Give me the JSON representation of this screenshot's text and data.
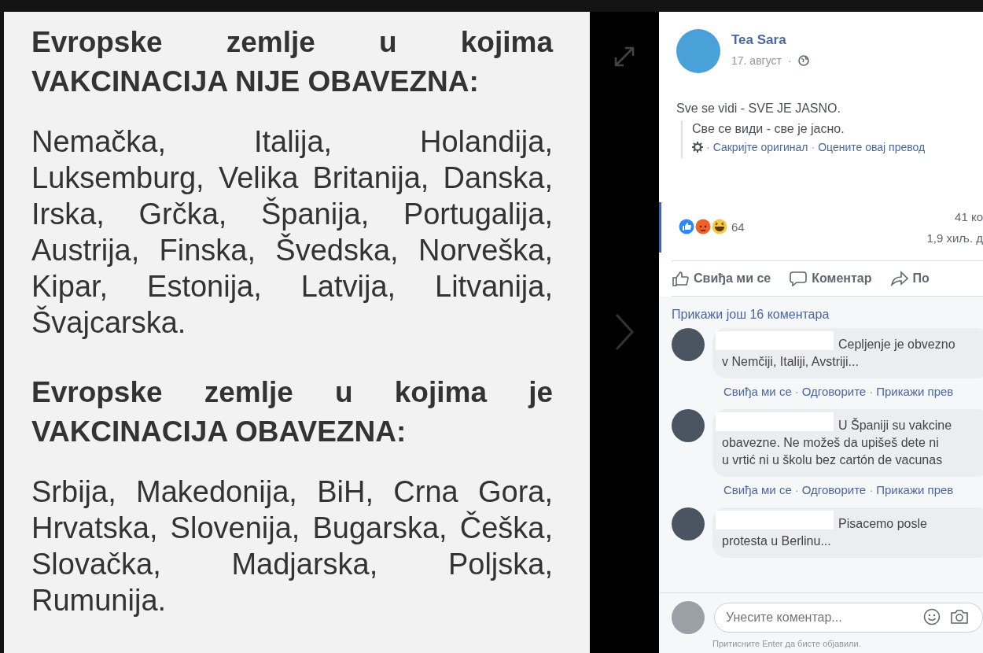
{
  "photo": {
    "paragraphs": [
      {
        "kind": "heading",
        "text": "Evropske zemlje u kojima VAKCINACIJA NIJE OBAVEZNA:"
      },
      {
        "kind": "list",
        "text": "Nemačka, Italija, Holandija, Luksemburg, Velika Britanija, Danska, Irska, Grčka, Španija, Portugalija, Austrija, Finska, Švedska, Norveška, Kipar, Estonija, Latvija, Litvanija, Švajcarska."
      },
      {
        "kind": "heading",
        "text": "Evropske zemlje u kojima je VAKCINACIJA OBAVEZNA:"
      },
      {
        "kind": "list",
        "text": "Srbija, Makedonija, BiH, Crna Gora, Hrvatska, Slovenija, Bugarska, Češka, Slovačka, Madjarska, Poljska, Rumunija."
      }
    ]
  },
  "post": {
    "author": "Tea Sara",
    "date": "17. август",
    "date_separator": "·",
    "caption": "Sve se vidi - SVE JE JASNO.",
    "translation": "Све се види - све је јасно.",
    "translation_links": [
      {
        "separator": "·",
        "label": "Сакријте оригинал"
      },
      {
        "separator": "·",
        "label": "Оцените овај превод"
      }
    ],
    "reaction_count": "64",
    "comment_count": "41 ко",
    "share_count": "1,9 хиљ. д",
    "actions": [
      {
        "kind": "like",
        "label": "Свиђа ми се"
      },
      {
        "kind": "comment",
        "label": "Коментар"
      },
      {
        "kind": "share",
        "label": "По"
      }
    ]
  },
  "comments": {
    "more_link": "Прикажи још 16 коментара",
    "items": [
      {
        "lines": [
          "Cepljenje je obvezno",
          "v Nemčiji, Italiji, Avstriji..."
        ],
        "actions": [
          {
            "label": "Свиђа ми се"
          },
          {
            "separator": "·",
            "label": "Одговорите"
          },
          {
            "separator": "·",
            "label": "Прикажи прев"
          }
        ]
      },
      {
        "lines": [
          "U Španiji su vakcine",
          "obavezne. Ne možeš da upišeš dete ni",
          "u vrtić ni u školu bez cartón de vacunas"
        ],
        "actions": [
          {
            "label": "Свиђа ми се"
          },
          {
            "separator": "·",
            "label": "Одговорите"
          },
          {
            "separator": "·",
            "label": "Прикажи прев"
          }
        ]
      },
      {
        "lines": [
          "Pisacemo posle",
          "protesta u Berlinu..."
        ]
      }
    ],
    "input": {
      "placeholder": "Унесите коментар...",
      "hint": "Притисните Enter да бисте објавили."
    }
  }
}
